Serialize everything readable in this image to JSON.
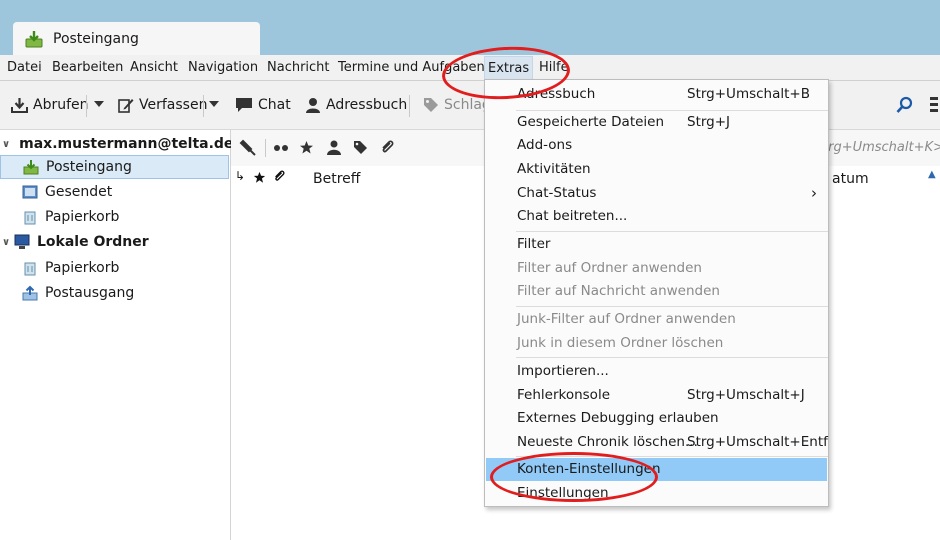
{
  "window": {
    "tab_label": "Posteingang"
  },
  "menubar": {
    "items": [
      {
        "label": "Datei"
      },
      {
        "label": "Bearbeiten"
      },
      {
        "label": "Ansicht"
      },
      {
        "label": "Navigation"
      },
      {
        "label": "Nachricht"
      },
      {
        "label": "Termine und Aufgaben"
      },
      {
        "label": "Extras"
      },
      {
        "label": "Hilfe"
      }
    ]
  },
  "toolbar": {
    "get_mail": "Abrufen",
    "compose": "Verfassen",
    "chat": "Chat",
    "address_book": "Adressbuch",
    "tags": "Schlag",
    "search_shortcut": "trg+Umschalt+K>"
  },
  "sidebar": {
    "account": "max.mustermann@telta.de",
    "account_folders": [
      "Posteingang",
      "Gesendet",
      "Papierkorb"
    ],
    "local": "Lokale Ordner",
    "local_folders": [
      "Papierkorb",
      "Postausgang"
    ]
  },
  "message_list": {
    "col_subject": "Betreff",
    "col_date": "atum"
  },
  "extras_menu": {
    "items": [
      {
        "label": "Adressbuch",
        "shortcut": "Strg+Umschalt+B",
        "disabled": false
      },
      {
        "label": "Gespeicherte Dateien",
        "shortcut": "Strg+J",
        "disabled": false
      },
      {
        "label": "Add-ons",
        "shortcut": "",
        "disabled": false
      },
      {
        "label": "Aktivitäten",
        "shortcut": "",
        "disabled": false
      },
      {
        "label": "Chat-Status",
        "shortcut": "",
        "disabled": false,
        "submenu": true
      },
      {
        "label": "Chat beitreten...",
        "shortcut": "",
        "disabled": false
      },
      {
        "label": "Filter",
        "shortcut": "",
        "disabled": false
      },
      {
        "label": "Filter auf Ordner anwenden",
        "shortcut": "",
        "disabled": true
      },
      {
        "label": "Filter auf Nachricht anwenden",
        "shortcut": "",
        "disabled": true
      },
      {
        "label": "Junk-Filter auf Ordner anwenden",
        "shortcut": "",
        "disabled": true
      },
      {
        "label": "Junk in diesem Ordner löschen",
        "shortcut": "",
        "disabled": true
      },
      {
        "label": "Importieren...",
        "shortcut": "",
        "disabled": false
      },
      {
        "label": "Fehlerkonsole",
        "shortcut": "Strg+Umschalt+J",
        "disabled": false
      },
      {
        "label": "Externes Debugging erlauben",
        "shortcut": "",
        "disabled": false
      },
      {
        "label": "Neueste Chronik löschen...",
        "shortcut": "Strg+Umschalt+Entf",
        "disabled": false
      },
      {
        "label": "Konten-Einstellungen",
        "shortcut": "",
        "disabled": false,
        "highlighted": true
      },
      {
        "label": "Einstellungen",
        "shortcut": "",
        "disabled": false
      }
    ],
    "submenu_arrow": "›"
  },
  "colors": {
    "titlebar": "#9dc6dd",
    "highlight": "#91c9f7",
    "annotation_ring": "#e11d1d"
  }
}
